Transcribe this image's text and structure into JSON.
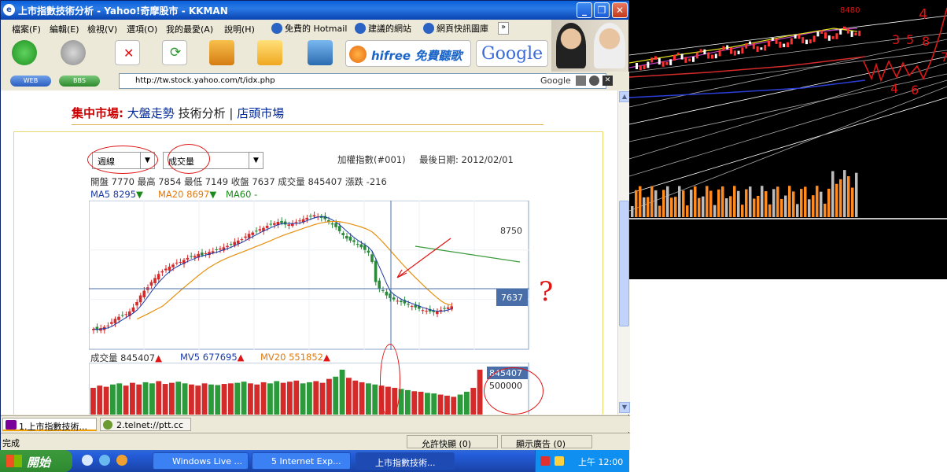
{
  "window": {
    "title": "上市指數技術分析 - Yahoo!奇摩股市 - KKMAN",
    "minimize": "_",
    "restore": "❐",
    "close": "✕"
  },
  "menu": [
    "檔案(F)",
    "編輯(E)",
    "檢視(V)",
    "選項(O)",
    "我的最愛(A)",
    "說明(H)"
  ],
  "links": [
    "免費的 Hotmail",
    "建議的網站",
    "網頁快訊圖庫"
  ],
  "toolbar": {
    "hifree": "hifree 免費聽歌",
    "google_logo": "Google",
    "web_btn": "WEB",
    "bbs_btn": "BBS"
  },
  "address": {
    "url": "http://tw.stock.yahoo.com/t/idx.php",
    "search_label": "Google"
  },
  "page": {
    "nav_prefix": "集中市場:",
    "nav_trend": "大盤走勢",
    "nav_tech": "技術分析",
    "nav_sep": "|",
    "nav_otc": "店頭市場",
    "period_select": "週線",
    "indicator_select": "成交量",
    "index_name": "加權指數(#001)",
    "latest_date": "最後日期: 2012/02/01",
    "ohlc": "開盤 7770  最高 7854  最低 7149  收盤 7637  成交量 845407  漲跌 -216",
    "ma5": "MA5 8295",
    "ma20": "MA20 8697",
    "ma60": "MA60 -",
    "vol_label": "成交量 845407",
    "mv5": "MV5 677695",
    "mv20": "MV20 551852",
    "price_tick": "8750",
    "price_last": "7637",
    "vol_last": "845407",
    "vol_tick": "500000",
    "question": "?"
  },
  "tabs": [
    "1.上市指數技術...",
    "2.telnet://ptt.cc"
  ],
  "status": {
    "text": "完成",
    "popup": "允許快顯 (0)",
    "ads": "顯示廣告 (0)"
  },
  "taskbar": {
    "start": "開始",
    "tasks": [
      "Windows Live ...",
      "5 Internet Exp...",
      "上市指數技術..."
    ],
    "clock": "上午 12:00"
  },
  "annotations": {
    "top_label": "8480",
    "nums": [
      "4",
      "3",
      "5",
      "8",
      "7",
      "4",
      "6"
    ]
  },
  "chart_data": {
    "type": "candlestick",
    "title": "加權指數(#001)",
    "ma_series": [
      "MA5",
      "MA20",
      "MA60"
    ],
    "last_close": 7637,
    "price_ticks": [
      8750,
      7637
    ],
    "volume_last": 845407,
    "volume_tick": 500000,
    "closes": [
      7300,
      7280,
      7310,
      7330,
      7350,
      7400,
      7450,
      7480,
      7500,
      7520,
      7560,
      7620,
      7700,
      7800,
      7870,
      7920,
      8000,
      8060,
      8120,
      8160,
      8200,
      8230,
      8260,
      8290,
      8300,
      8330,
      8360,
      8380,
      8390,
      8420,
      8400,
      8430,
      8450,
      8460,
      8480,
      8500,
      8520,
      8540,
      8560,
      8600,
      8620,
      8640,
      8680,
      8720,
      8740,
      8760,
      8790,
      8810,
      8840,
      8860,
      8880,
      8900,
      8880,
      8860,
      8860,
      8870,
      8900,
      8920,
      8940,
      8960,
      8980,
      9000,
      8980,
      8960,
      8940,
      8900,
      8860,
      8820,
      8760,
      8700,
      8650,
      8620,
      8600,
      8560,
      8520,
      8480,
      8440,
      8300,
      8000,
      7900,
      7870,
      7800,
      7760,
      7740,
      7720,
      7700,
      7680,
      7660,
      7640,
      7620,
      7600,
      7580,
      7570,
      7560,
      7550,
      7560,
      7580,
      7600,
      7620,
      7637
    ],
    "volumes": [
      520000,
      560000,
      540000,
      580000,
      600000,
      560000,
      610000,
      580000,
      620000,
      600000,
      640000,
      590000,
      610000,
      630000,
      600000,
      580000,
      560000,
      600000,
      580000,
      570000,
      590000,
      600000,
      610000,
      630000,
      600000,
      580000,
      620000,
      600000,
      640000,
      610000,
      630000,
      650000,
      600000,
      620000,
      640000,
      610000,
      680000,
      720000,
      845407,
      700000,
      650000,
      620000,
      600000,
      580000,
      560000,
      540000,
      520000,
      500000,
      480000,
      460000,
      450000,
      430000,
      420000,
      400000,
      380000,
      360000,
      400000,
      450000,
      520000,
      845407
    ]
  }
}
